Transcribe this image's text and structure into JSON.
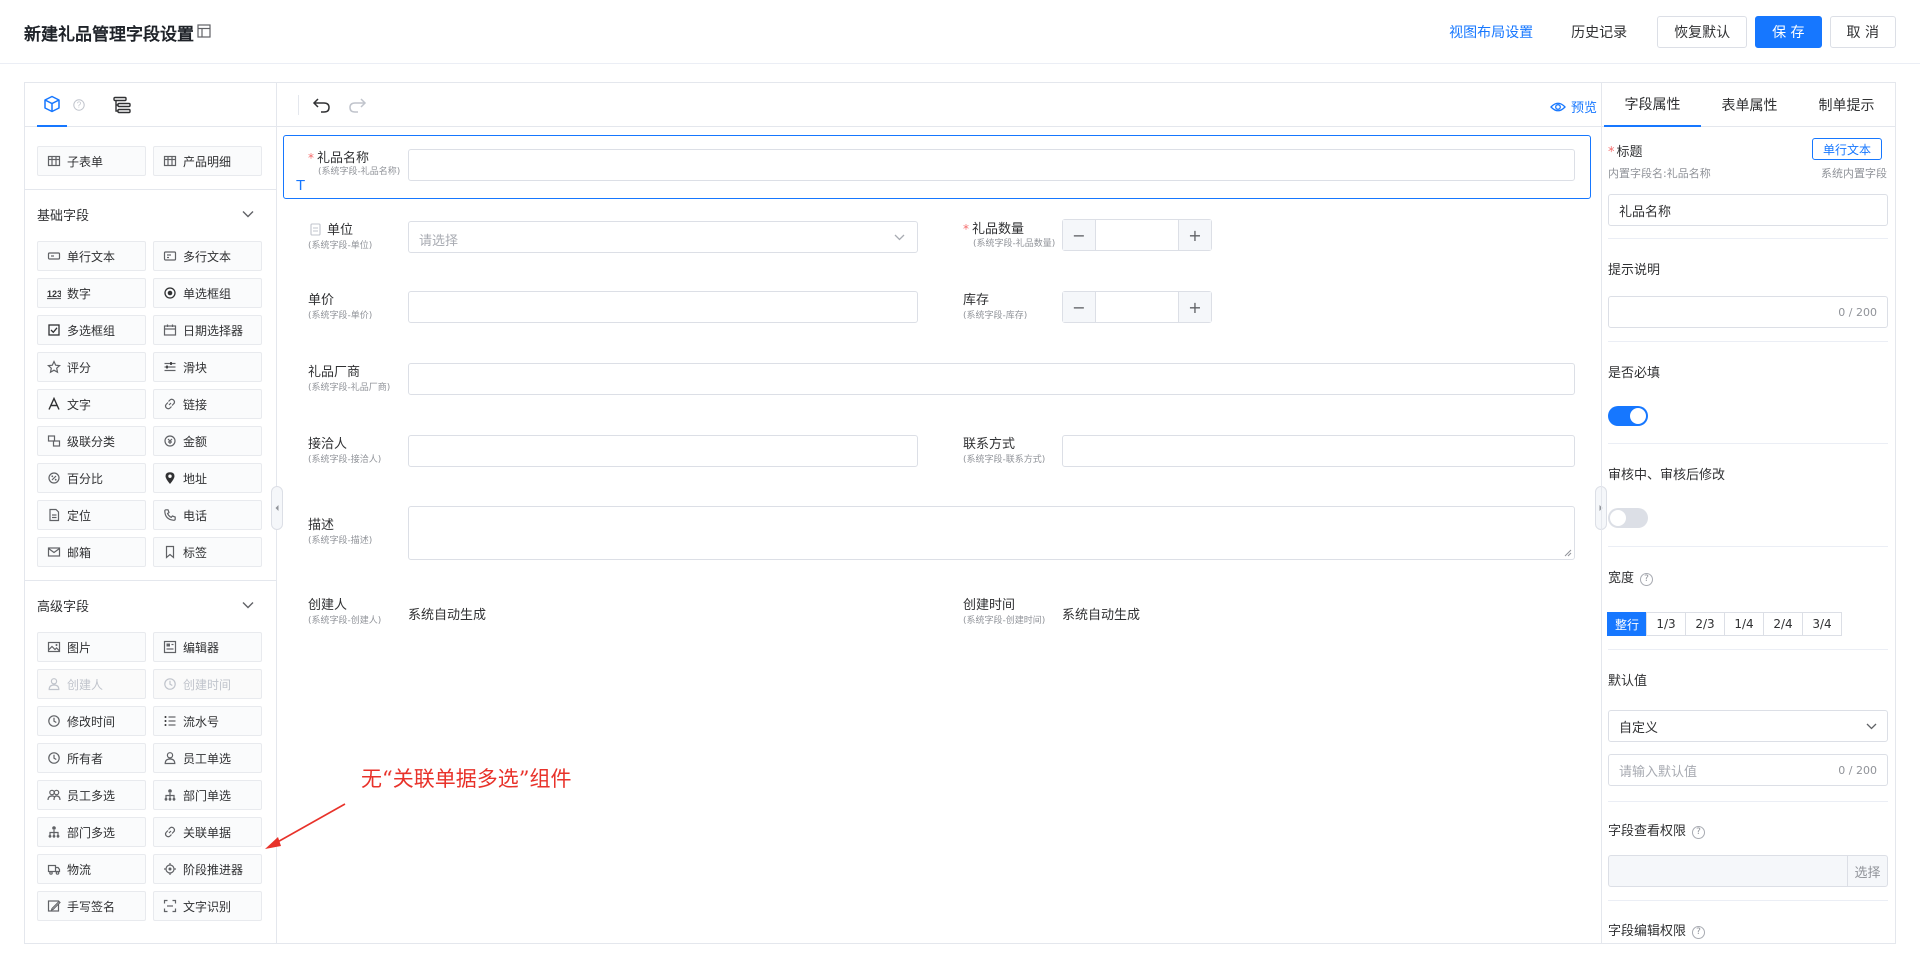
{
  "header": {
    "title": "新建礼品管理字段设置",
    "links": {
      "view_layout": "视图布局设置",
      "history": "历史记录"
    },
    "buttons": {
      "restore": "恢复默认",
      "save": "保 存",
      "cancel": "取 消"
    }
  },
  "left_panel": {
    "top_items": [
      {
        "label": "子表单",
        "icon": "table-icon"
      },
      {
        "label": "产品明细",
        "icon": "table-icon"
      }
    ],
    "basic": {
      "title": "基础字段",
      "items": [
        {
          "label": "单行文本",
          "icon": "single-line-icon"
        },
        {
          "label": "多行文本",
          "icon": "multi-line-icon"
        },
        {
          "label": "数字",
          "icon": "number-icon"
        },
        {
          "label": "单选框组",
          "icon": "radio-icon"
        },
        {
          "label": "多选框组",
          "icon": "checkbox-icon"
        },
        {
          "label": "日期选择器",
          "icon": "calendar-icon"
        },
        {
          "label": "评分",
          "icon": "star-icon"
        },
        {
          "label": "滑块",
          "icon": "slider-icon"
        },
        {
          "label": "文字",
          "icon": "text-icon"
        },
        {
          "label": "链接",
          "icon": "link-icon"
        },
        {
          "label": "级联分类",
          "icon": "cascade-icon"
        },
        {
          "label": "金额",
          "icon": "amount-icon"
        },
        {
          "label": "百分比",
          "icon": "percent-icon"
        },
        {
          "label": "地址",
          "icon": "location-pin-icon"
        },
        {
          "label": "定位",
          "icon": "file-icon"
        },
        {
          "label": "电话",
          "icon": "phone-icon"
        },
        {
          "label": "邮箱",
          "icon": "mail-icon"
        },
        {
          "label": "标签",
          "icon": "bookmark-icon"
        }
      ]
    },
    "advanced": {
      "title": "高级字段",
      "items": [
        {
          "label": "图片",
          "icon": "image-icon"
        },
        {
          "label": "编辑器",
          "icon": "editor-icon"
        },
        {
          "label": "创建人",
          "icon": "user-icon",
          "disabled": true
        },
        {
          "label": "创建时间",
          "icon": "clock-icon",
          "disabled": true
        },
        {
          "label": "修改时间",
          "icon": "clock-icon"
        },
        {
          "label": "流水号",
          "icon": "list-number-icon"
        },
        {
          "label": "所有者",
          "icon": "clock-icon"
        },
        {
          "label": "员工单选",
          "icon": "user-icon"
        },
        {
          "label": "员工多选",
          "icon": "users-icon"
        },
        {
          "label": "部门单选",
          "icon": "org-icon"
        },
        {
          "label": "部门多选",
          "icon": "org-icon"
        },
        {
          "label": "关联单据",
          "icon": "link-icon"
        },
        {
          "label": "物流",
          "icon": "truck-icon"
        },
        {
          "label": "阶段推进器",
          "icon": "stage-icon"
        },
        {
          "label": "手写签名",
          "icon": "signature-icon"
        },
        {
          "label": "文字识别",
          "icon": "scan-icon"
        }
      ]
    }
  },
  "canvas": {
    "preview": "预览",
    "fields": {
      "gift_name": {
        "label": "礼品名称",
        "sub": "(系统字段-礼品名称)"
      },
      "unit": {
        "label": "单位",
        "sub": "(系统字段-单位)",
        "placeholder": "请选择"
      },
      "gift_qty": {
        "label": "礼品数量",
        "sub": "(系统字段-礼品数量)"
      },
      "price": {
        "label": "单价",
        "sub": "(系统字段-单价)"
      },
      "stock": {
        "label": "库存",
        "sub": "(系统字段-库存)"
      },
      "vendor": {
        "label": "礼品厂商",
        "sub": "(系统字段-礼品厂商)"
      },
      "contact_person": {
        "label": "接洽人",
        "sub": "(系统字段-接洽人)"
      },
      "contact": {
        "label": "联系方式",
        "sub": "(系统字段-联系方式)"
      },
      "desc": {
        "label": "描述",
        "sub": "(系统字段-描述)"
      },
      "creator": {
        "label": "创建人",
        "sub": "(系统字段-创建人)",
        "value": "系统自动生成"
      },
      "created_at": {
        "label": "创建时间",
        "sub": "(系统字段-创建时间)",
        "value": "系统自动生成"
      }
    }
  },
  "right_panel": {
    "tabs": [
      "字段属性",
      "表单属性",
      "制单提示"
    ],
    "title_label": "标题",
    "type_badge": "单行文本",
    "builtin_name": "内置字段名:礼品名称",
    "builtin_tag": "系统内置字段",
    "title_value": "礼品名称",
    "hint_label": "提示说明",
    "hint_counter": "0 / 200",
    "required_label": "是否必填",
    "required_on": true,
    "review_label": "审核中、审核后修改",
    "review_on": false,
    "width_label": "宽度",
    "width_options": [
      "整行",
      "1/3",
      "2/3",
      "1/4",
      "2/4",
      "3/4"
    ],
    "width_selected": 0,
    "default_label": "默认值",
    "default_mode": "自定义",
    "default_placeholder": "请输入默认值",
    "default_counter": "0 / 200",
    "view_perm_label": "字段查看权限",
    "choose": "选择",
    "edit_perm_label": "字段编辑权限"
  },
  "annotation": "无“关联单据多选”组件",
  "colors": {
    "primary": "#1677ff",
    "required": "#f56c6c",
    "annotation": "#e8322a"
  }
}
